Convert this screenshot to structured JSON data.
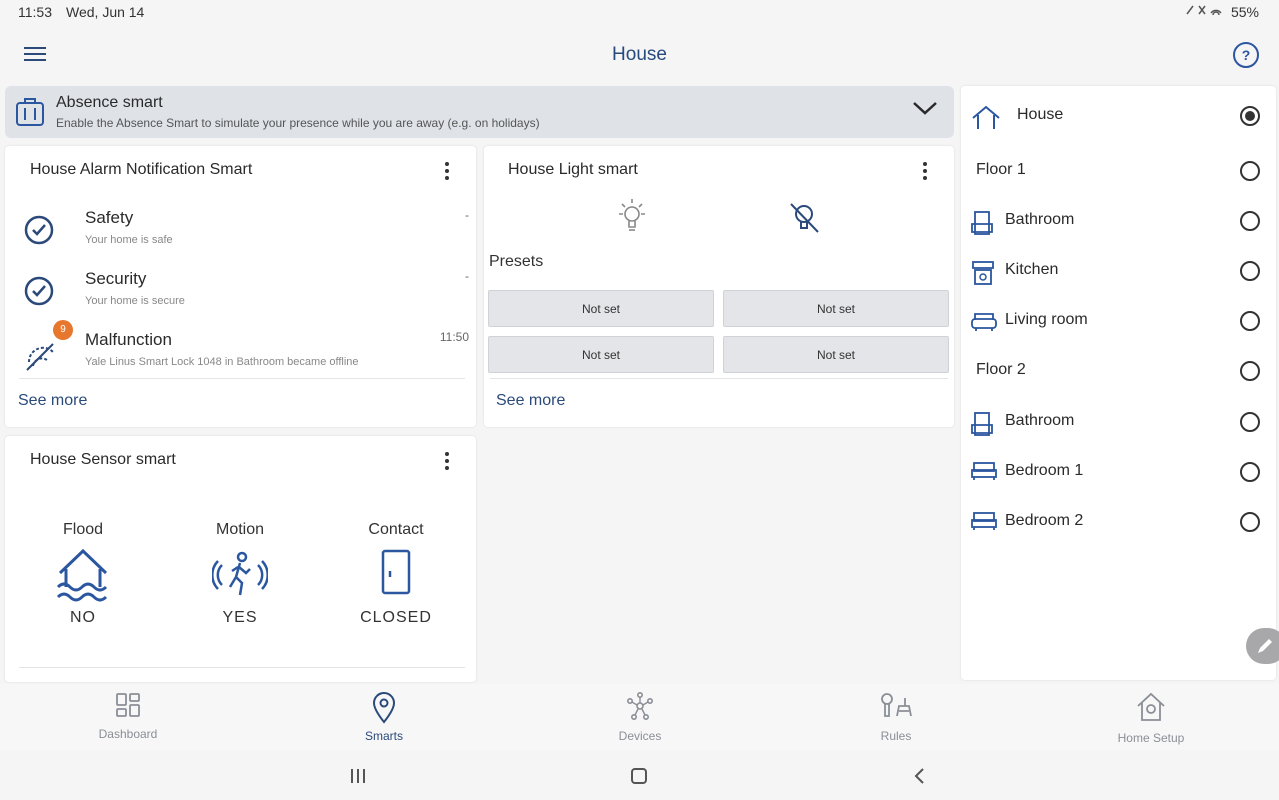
{
  "status_bar": {
    "time": "11:53",
    "date": "Wed, Jun 14",
    "battery": "55%"
  },
  "app_bar": {
    "title": "House",
    "help": "?"
  },
  "absence": {
    "title": "Absence smart",
    "description": "Enable the Absence Smart to simulate your presence while you are away (e.g. on holidays)"
  },
  "alarm_card": {
    "title": "House Alarm Notification Smart",
    "rows": [
      {
        "title": "Safety",
        "subtitle": "Your home is safe",
        "right": "-"
      },
      {
        "title": "Security",
        "subtitle": "Your home is secure",
        "right": "-"
      },
      {
        "title": "Malfunction",
        "subtitle": "Yale Linus Smart Lock 1048 in Bathroom became offline",
        "right": "11:50",
        "badge": "9"
      }
    ],
    "see_more": "See more"
  },
  "light_card": {
    "title": "House Light smart",
    "presets_label": "Presets",
    "presets": [
      "Not set",
      "Not set",
      "Not set",
      "Not set"
    ],
    "see_more": "See more"
  },
  "sensor_card": {
    "title": "House Sensor smart",
    "sensors": [
      {
        "label": "Flood",
        "value": "NO",
        "icon": "flood-icon"
      },
      {
        "label": "Motion",
        "value": "YES",
        "icon": "motion-icon"
      },
      {
        "label": "Contact",
        "value": "CLOSED",
        "icon": "door-icon"
      }
    ]
  },
  "locations": [
    {
      "label": "House",
      "icon": "home-icon",
      "selected": true
    },
    {
      "label": "Floor 1",
      "icon": "",
      "selected": false
    },
    {
      "label": "Bathroom",
      "icon": "bath-icon",
      "selected": false
    },
    {
      "label": "Kitchen",
      "icon": "kitchen-icon",
      "selected": false
    },
    {
      "label": "Living room",
      "icon": "sofa-icon",
      "selected": false
    },
    {
      "label": "Floor 2",
      "icon": "",
      "selected": false
    },
    {
      "label": "Bathroom",
      "icon": "bath-icon",
      "selected": false
    },
    {
      "label": "Bedroom 1",
      "icon": "bed-icon",
      "selected": false
    },
    {
      "label": "Bedroom 2",
      "icon": "bed-icon",
      "selected": false
    }
  ],
  "bottom_nav": [
    {
      "label": "Dashboard",
      "icon": "dashboard-icon",
      "active": false
    },
    {
      "label": "Smarts",
      "icon": "smarts-icon",
      "active": true
    },
    {
      "label": "Devices",
      "icon": "devices-icon",
      "active": false
    },
    {
      "label": "Rules",
      "icon": "rules-icon",
      "active": false
    },
    {
      "label": "Home Setup",
      "icon": "home-setup-icon",
      "active": false
    }
  ],
  "colors": {
    "accent": "#2b4a7a",
    "badge": "#e8772e",
    "banner": "#dfe3e8"
  }
}
